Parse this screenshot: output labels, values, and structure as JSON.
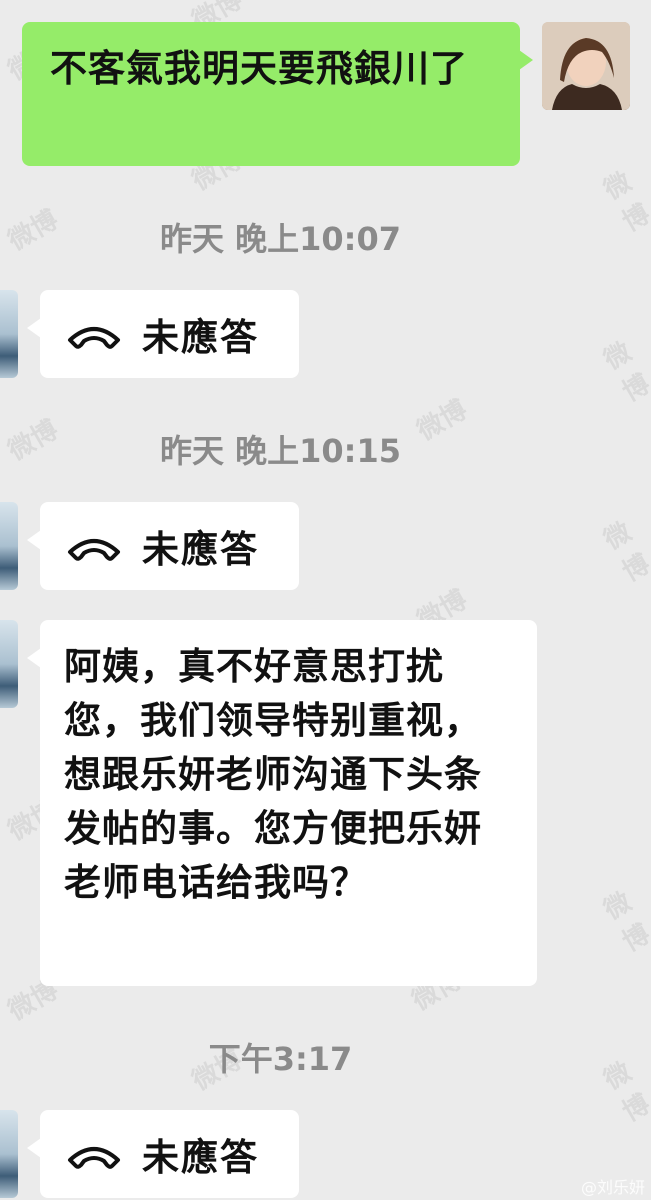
{
  "messages": {
    "m1": "不客氣我明天要飛銀川了",
    "t1": "昨天 晚上10:07",
    "c1": "未應答",
    "t2": "昨天 晚上10:15",
    "c2": "未應答",
    "m2": "阿姨，真不好意思打扰您，我们领导特别重视，想跟乐妍老师沟通下头条发帖的事。您方便把乐妍老师电话给我吗？",
    "t3": "下午3:17",
    "c3": "未應答"
  },
  "watermark": {
    "text": "微博",
    "footer": "@刘乐妍"
  },
  "colors": {
    "background": "#ebebeb",
    "sent_bubble": "#95ec69",
    "received_bubble": "#ffffff",
    "timestamp": "#8a8a8a"
  },
  "icons": {
    "call": "phone-handset-icon"
  }
}
